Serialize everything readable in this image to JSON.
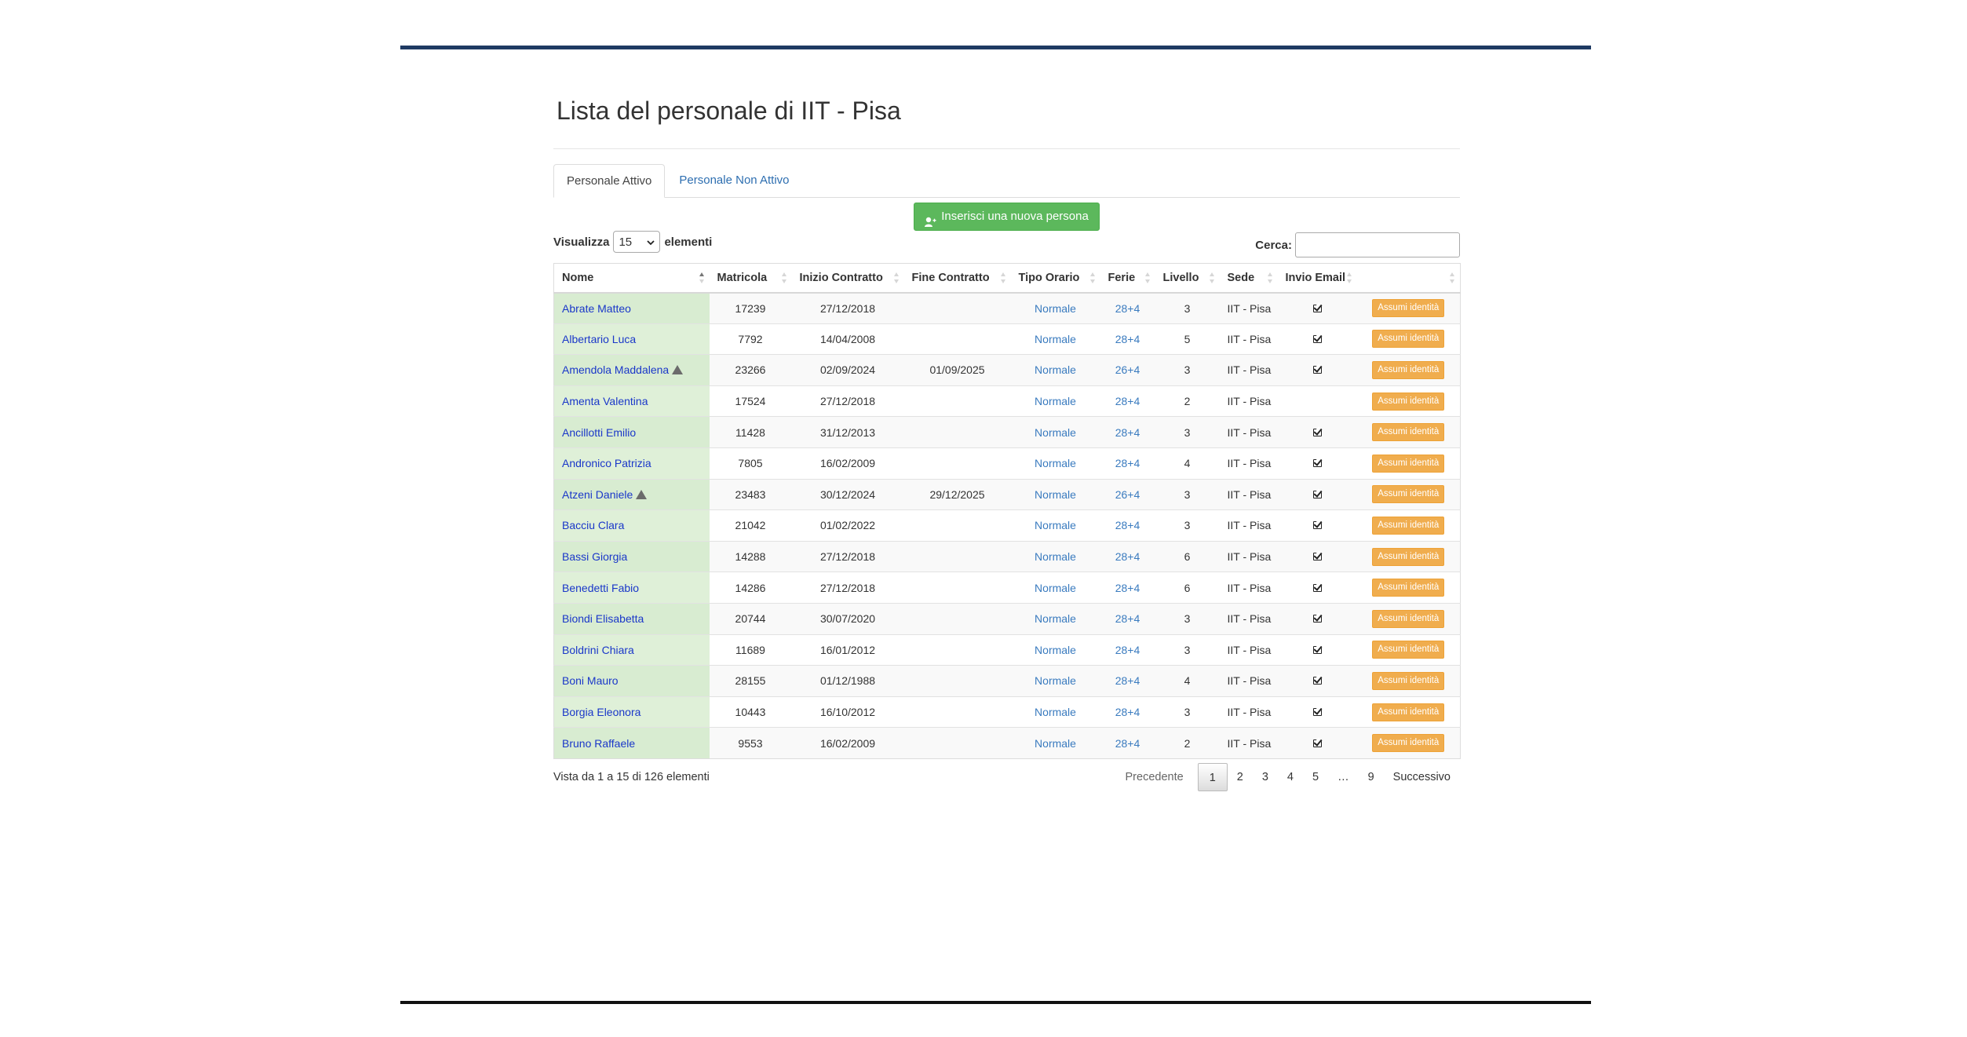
{
  "title": "Lista del personale di IIT - Pisa",
  "tabs": [
    {
      "label": "Personale Attivo",
      "active": true
    },
    {
      "label": "Personale Non Attivo",
      "active": false
    }
  ],
  "new_person_button": "Inserisci una nuova persona",
  "length": {
    "prefix": "Visualizza",
    "value": "15",
    "suffix": "elementi"
  },
  "search": {
    "label": "Cerca:",
    "value": ""
  },
  "columns": [
    "Nome",
    "Matricola",
    "Inizio Contratto",
    "Fine Contratto",
    "Tipo Orario",
    "Ferie",
    "Livello",
    "Sede",
    "Invio Email",
    ""
  ],
  "rows": [
    {
      "nome": "Abrate Matteo",
      "warning": false,
      "matricola": "17239",
      "inizio": "27/12/2018",
      "fine": "",
      "orario": "Normale",
      "ferie": "28+4",
      "livello": "3",
      "sede": "IIT - Pisa",
      "email": true,
      "action": "Assumi identità"
    },
    {
      "nome": "Albertario Luca",
      "warning": false,
      "matricola": "7792",
      "inizio": "14/04/2008",
      "fine": "",
      "orario": "Normale",
      "ferie": "28+4",
      "livello": "5",
      "sede": "IIT - Pisa",
      "email": true,
      "action": "Assumi identità"
    },
    {
      "nome": "Amendola Maddalena",
      "warning": true,
      "matricola": "23266",
      "inizio": "02/09/2024",
      "fine": "01/09/2025",
      "orario": "Normale",
      "ferie": "26+4",
      "livello": "3",
      "sede": "IIT - Pisa",
      "email": true,
      "action": "Assumi identità"
    },
    {
      "nome": "Amenta Valentina",
      "warning": false,
      "matricola": "17524",
      "inizio": "27/12/2018",
      "fine": "",
      "orario": "Normale",
      "ferie": "28+4",
      "livello": "2",
      "sede": "IIT - Pisa",
      "email": false,
      "action": "Assumi identità"
    },
    {
      "nome": "Ancillotti Emilio",
      "warning": false,
      "matricola": "11428",
      "inizio": "31/12/2013",
      "fine": "",
      "orario": "Normale",
      "ferie": "28+4",
      "livello": "3",
      "sede": "IIT - Pisa",
      "email": true,
      "action": "Assumi identità"
    },
    {
      "nome": "Andronico Patrizia",
      "warning": false,
      "matricola": "7805",
      "inizio": "16/02/2009",
      "fine": "",
      "orario": "Normale",
      "ferie": "28+4",
      "livello": "4",
      "sede": "IIT - Pisa",
      "email": true,
      "action": "Assumi identità"
    },
    {
      "nome": "Atzeni Daniele",
      "warning": true,
      "matricola": "23483",
      "inizio": "30/12/2024",
      "fine": "29/12/2025",
      "orario": "Normale",
      "ferie": "26+4",
      "livello": "3",
      "sede": "IIT - Pisa",
      "email": true,
      "action": "Assumi identità"
    },
    {
      "nome": "Bacciu Clara",
      "warning": false,
      "matricola": "21042",
      "inizio": "01/02/2022",
      "fine": "",
      "orario": "Normale",
      "ferie": "28+4",
      "livello": "3",
      "sede": "IIT - Pisa",
      "email": true,
      "action": "Assumi identità"
    },
    {
      "nome": "Bassi Giorgia",
      "warning": false,
      "matricola": "14288",
      "inizio": "27/12/2018",
      "fine": "",
      "orario": "Normale",
      "ferie": "28+4",
      "livello": "6",
      "sede": "IIT - Pisa",
      "email": true,
      "action": "Assumi identità"
    },
    {
      "nome": "Benedetti Fabio",
      "warning": false,
      "matricola": "14286",
      "inizio": "27/12/2018",
      "fine": "",
      "orario": "Normale",
      "ferie": "28+4",
      "livello": "6",
      "sede": "IIT - Pisa",
      "email": true,
      "action": "Assumi identità"
    },
    {
      "nome": "Biondi Elisabetta",
      "warning": false,
      "matricola": "20744",
      "inizio": "30/07/2020",
      "fine": "",
      "orario": "Normale",
      "ferie": "28+4",
      "livello": "3",
      "sede": "IIT - Pisa",
      "email": true,
      "action": "Assumi identità"
    },
    {
      "nome": "Boldrini Chiara",
      "warning": false,
      "matricola": "11689",
      "inizio": "16/01/2012",
      "fine": "",
      "orario": "Normale",
      "ferie": "28+4",
      "livello": "3",
      "sede": "IIT - Pisa",
      "email": true,
      "action": "Assumi identità"
    },
    {
      "nome": "Boni Mauro",
      "warning": false,
      "matricola": "28155",
      "inizio": "01/12/1988",
      "fine": "",
      "orario": "Normale",
      "ferie": "28+4",
      "livello": "4",
      "sede": "IIT - Pisa",
      "email": true,
      "action": "Assumi identità"
    },
    {
      "nome": "Borgia Eleonora",
      "warning": false,
      "matricola": "10443",
      "inizio": "16/10/2012",
      "fine": "",
      "orario": "Normale",
      "ferie": "28+4",
      "livello": "3",
      "sede": "IIT - Pisa",
      "email": true,
      "action": "Assumi identità"
    },
    {
      "nome": "Bruno Raffaele",
      "warning": false,
      "matricola": "9553",
      "inizio": "16/02/2009",
      "fine": "",
      "orario": "Normale",
      "ferie": "28+4",
      "livello": "2",
      "sede": "IIT - Pisa",
      "email": true,
      "action": "Assumi identità"
    }
  ],
  "info": "Vista da 1 a 15 di 126 elementi",
  "pagination": {
    "prev": "Precedente",
    "pages": [
      "1",
      "2",
      "3",
      "4",
      "5",
      "…",
      "9"
    ],
    "current": "1",
    "next": "Successivo"
  },
  "colors": {
    "primary_rule": "#1f3a63",
    "name_cell": "#dff0d8",
    "action": "#f0ad4e",
    "new_button": "#5cb85c",
    "link": "#1a37c9"
  }
}
